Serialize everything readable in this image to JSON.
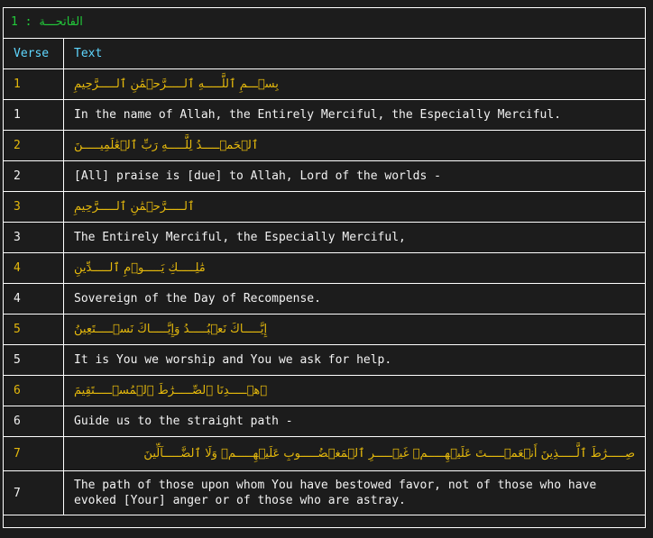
{
  "title": {
    "surah": "الفاتحـــة",
    "separator": ":",
    "number": "1"
  },
  "table": {
    "headers": [
      "Verse",
      "Text"
    ],
    "rows": [
      {
        "verse": "1",
        "arabic": "بِسۡـــمِ ٱللَّـــــهِ ٱلـــــرَّحۡمَٰنِ ٱلـــــرَّحِيمِ",
        "english": "In the name of Allah, the Entirely Merciful, the Especially Merciful."
      },
      {
        "verse": "2",
        "arabic": "ٱلۡحَمۡـــــدُ لِلَّـــــهِ رَبِّ ٱلۡعَٰلَمِيـــــنَ",
        "english": "[All] praise is [due] to Allah, Lord of the worlds -"
      },
      {
        "verse": "3",
        "arabic": "ٱلـــــرَّحۡمَٰنِ ٱلـــــرَّحِيمِ",
        "english": "The Entirely Merciful, the Especially Merciful,"
      },
      {
        "verse": "4",
        "arabic": "مَٰلِـــــكِ يَـــــوۡمِ ٱلـــــدِّينِ",
        "english": "Sovereign of the Day of Recompense."
      },
      {
        "verse": "5",
        "arabic": "إِيَّـــــاكَ نَعۡبُـــــدُ وَإِيَّـــــاكَ نَسۡـــــتَعِينُ",
        "english": "It is You we worship and You we ask for help."
      },
      {
        "verse": "6",
        "arabic": "ٱهۡـــــدِنَا ٱلصِّـــــرَٰطَ ٱلۡمُسۡـــــتَقِيمَ",
        "english": "Guide us to the straight path -"
      },
      {
        "verse": "7",
        "arabic": "صِـــــرَٰطَ ٱلَّـــــذِينَ أَنۡعَمۡـــــتَ عَلَيۡهِـــــمۡ غَيۡـــــرِ ٱلۡمَغۡضُـــــوبِ عَلَيۡهِـــــمۡ وَلَا ٱلضَّـــــآلِّينَ",
        "english": "The path of those upon whom You have bestowed favor, not of those who have evoked [Your] anger or of those who are astray."
      }
    ]
  },
  "colors": {
    "background": "#1c1c1c",
    "title": "#22c93a",
    "header": "#5fd7ff",
    "arabic": "#e5b90c",
    "english": "#f2f2f2",
    "border": "#ffffff"
  }
}
